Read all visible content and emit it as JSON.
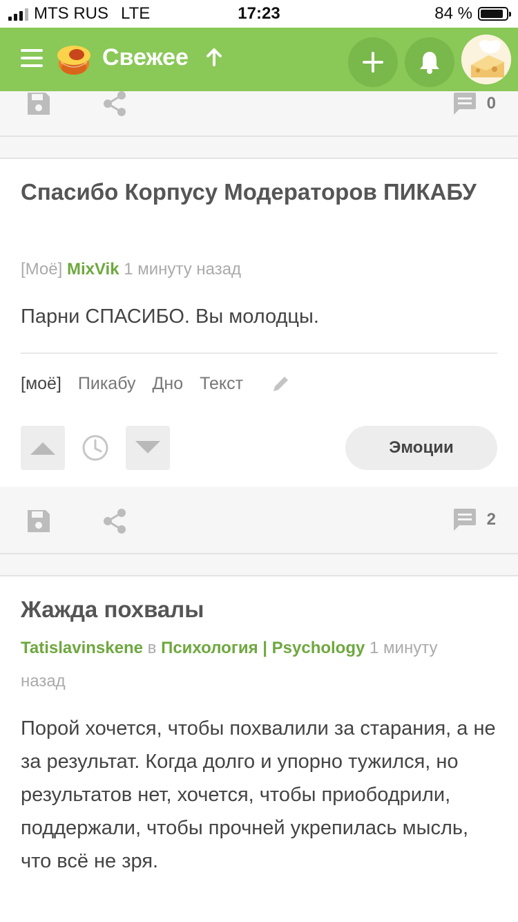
{
  "status_bar": {
    "carrier": "MTS RUS",
    "network": "LTE",
    "time": "17:23",
    "battery": "84 %"
  },
  "header": {
    "title": "Свежее",
    "accent_color": "#8ac858",
    "icons": [
      "menu-icon",
      "pikabu-logo",
      "sort-arrow-up-icon",
      "plus-icon",
      "bell-icon",
      "avatar"
    ]
  },
  "prev_post": {
    "comment_count": "0"
  },
  "post1": {
    "title": "Спасибо Корпусу Модераторов ПИКАБУ",
    "meta_prefix": "[Моё]",
    "author": "MixVik",
    "time": "1 минуту назад",
    "text": "Парни СПАСИБО. Вы молодцы.",
    "tags": [
      "[моё]",
      "Пикабу",
      "Дно",
      "Текст"
    ],
    "emotions_label": "Эмоции",
    "comment_count": "2"
  },
  "post2": {
    "title": "Жажда похвалы",
    "author": "Tatislavinskene",
    "in_word": "в",
    "community": "Психология | Psychology",
    "time_part1": "1 минуту",
    "time_part2": "назад",
    "text": "Порой хочется, чтобы похвалили за старания, а не за результат. Когда долго и упорно тужился, но результатов нет, хочется, чтобы приободрили, поддержали, чтобы прочней укрепилась мысль, что всё не зря."
  }
}
